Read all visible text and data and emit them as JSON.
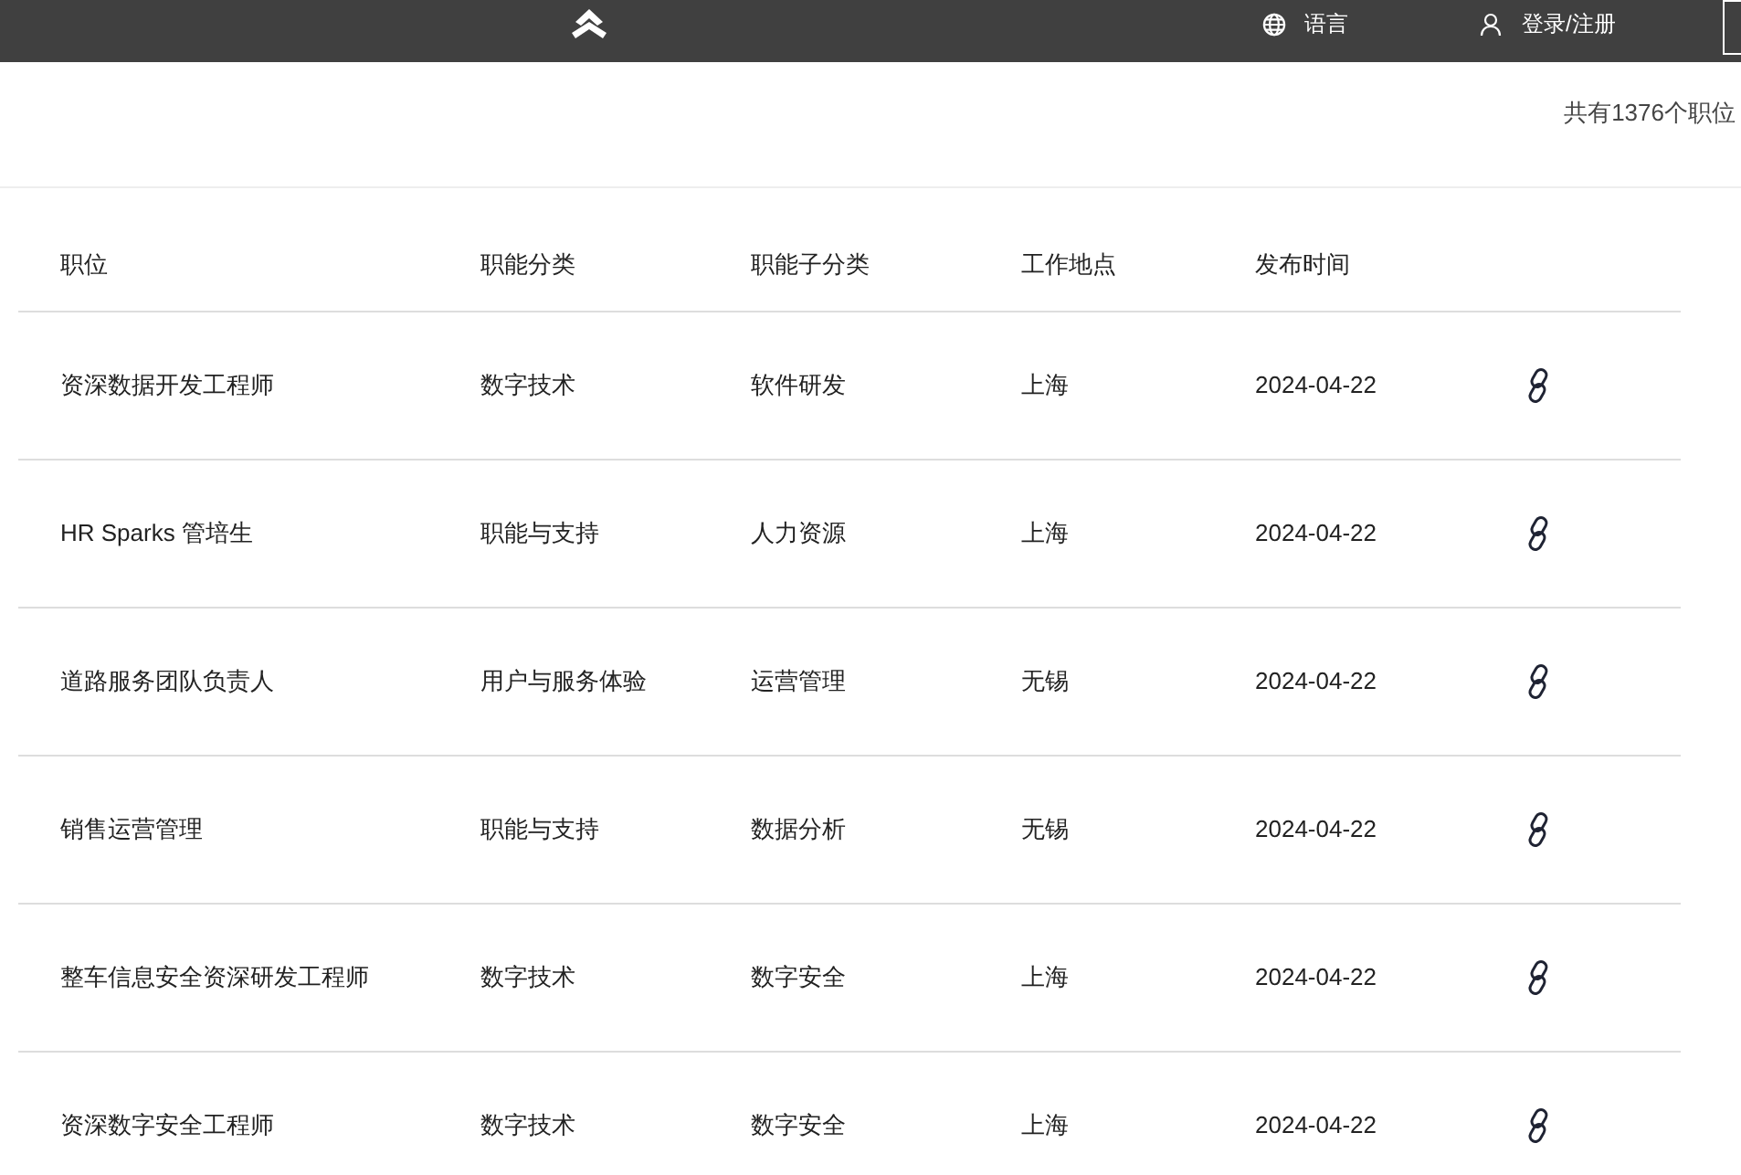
{
  "header": {
    "language": "语言",
    "login": "登录/注册"
  },
  "summary": "共有1376个职位",
  "table": {
    "columns": [
      "职位",
      "职能分类",
      "职能子分类",
      "工作地点",
      "发布时间"
    ],
    "rows": [
      {
        "cells": [
          "资深数据开发工程师",
          "数字技术",
          "软件研发",
          "上海",
          "2024-04-22"
        ]
      },
      {
        "cells": [
          "HR Sparks 管培生",
          "职能与支持",
          "人力资源",
          "上海",
          "2024-04-22"
        ]
      },
      {
        "cells": [
          "道路服务团队负责人",
          "用户与服务体验",
          "运营管理",
          "无锡",
          "2024-04-22"
        ]
      },
      {
        "cells": [
          "销售运营管理",
          "职能与支持",
          "数据分析",
          "无锡",
          "2024-04-22"
        ]
      },
      {
        "cells": [
          "整车信息安全资深研发工程师",
          "数字技术",
          "数字安全",
          "上海",
          "2024-04-22"
        ]
      },
      {
        "cells": [
          "资深数字安全工程师",
          "数字技术",
          "数字安全",
          "上海",
          "2024-04-22"
        ]
      }
    ]
  }
}
